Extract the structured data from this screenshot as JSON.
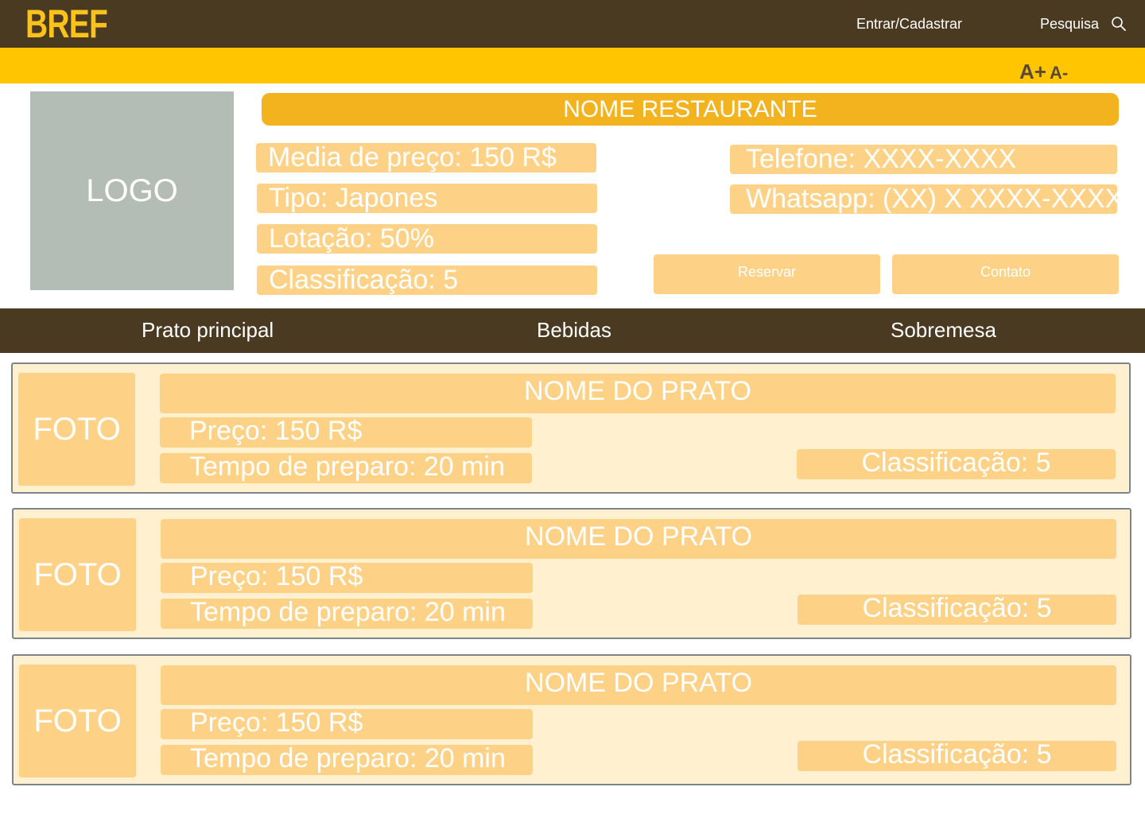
{
  "header": {
    "brand": "BREF",
    "login_label": "Entrar/Cadastrar",
    "search_label": "Pesquisa",
    "search_icon": "search-icon"
  },
  "accessibility": {
    "font_increase": "A+",
    "font_decrease": "A-"
  },
  "restaurant": {
    "logo_label": "LOGO",
    "name": "NOME RESTAURANTE",
    "price_avg": "Media de preço: 150 R$",
    "type": "Tipo: Japones",
    "capacity": "Lotação: 50%",
    "rating": "Classificação: 5",
    "phone": "Telefone: XXXX-XXXX",
    "whatsapp": "Whatsapp: (XX) X XXXX-XXXX",
    "reserve_label": "Reservar",
    "contact_label": "Contato"
  },
  "menu_tabs": [
    "Prato principal",
    "Bebidas",
    "Sobremesa"
  ],
  "dishes": [
    {
      "photo": "FOTO",
      "name": "NOME DO PRATO",
      "price": "Preço: 150 R$",
      "prep_time": "Tempo de preparo: 20 min",
      "rating": "Classificação: 5"
    },
    {
      "photo": "FOTO",
      "name": "NOME DO PRATO",
      "price": "Preço: 150 R$",
      "prep_time": "Tempo de preparo: 20 min",
      "rating": "Classificação: 5"
    },
    {
      "photo": "FOTO",
      "name": "NOME DO PRATO",
      "price": "Preço: 150 R$",
      "prep_time": "Tempo de preparo: 20 min",
      "rating": "Classificação: 5"
    }
  ],
  "colors": {
    "header_brown": "#4a3a22",
    "accent_yellow": "#ffc600",
    "brand_yellow": "#fbc21a",
    "pill_orange": "#fdd287",
    "title_orange": "#f2b31e",
    "card_bg": "#fff1d0",
    "logo_gray": "#b3bcb5"
  }
}
